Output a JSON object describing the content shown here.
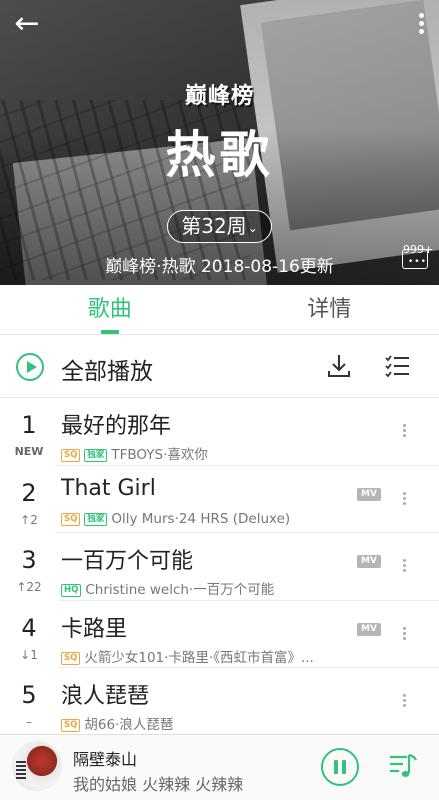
{
  "header": {
    "back_icon": "arrow-left-icon",
    "more_icon": "vertical-dots-icon",
    "chart_logo": "巅峰榜",
    "chart_title": "热歌",
    "week_label": "第32周",
    "update_text": "巅峰榜·热歌 2018-08-16更新",
    "comment_count": "999+",
    "comment_icon": "comment-bubble-icon"
  },
  "tabs": [
    {
      "label": "歌曲",
      "active": true
    },
    {
      "label": "详情",
      "active": false
    }
  ],
  "play_all": {
    "label": "全部播放",
    "play_icon": "play-circle-icon",
    "download_icon": "download-icon",
    "multi_select_icon": "list-select-icon"
  },
  "songs": [
    {
      "rank": "1",
      "trend": "NEW",
      "title": "最好的那年",
      "quality": "SQ",
      "exclusive": "独家",
      "info": "TFBOYS·喜欢你",
      "mv": ""
    },
    {
      "rank": "2",
      "trend": "↑2",
      "title": "That Girl",
      "quality": "SQ",
      "exclusive": "独家",
      "info": "Olly Murs·24 HRS (Deluxe)",
      "mv": "MV"
    },
    {
      "rank": "3",
      "trend": "↑22",
      "title": "一百万个可能",
      "quality": "HQ",
      "exclusive": "",
      "info": "Christine welch·一百万个可能",
      "mv": "MV"
    },
    {
      "rank": "4",
      "trend": "↓1",
      "title": "卡路里",
      "quality": "SQ",
      "exclusive": "",
      "info": "火箭少女101·卡路里·《西虹市首富》...",
      "mv": "MV"
    },
    {
      "rank": "5",
      "trend": "–",
      "title": "浪人琵琶",
      "quality": "SQ",
      "exclusive": "",
      "info": "胡66·浪人琵琶",
      "mv": ""
    }
  ],
  "player": {
    "song_name": "隔壁泰山",
    "lyric": "我的姑娘 火辣辣 火辣辣",
    "pause_icon": "pause-circle-icon",
    "queue_icon": "playlist-icon"
  },
  "colors": {
    "accent": "#31c27c",
    "sq_tag": "#f0a640"
  }
}
